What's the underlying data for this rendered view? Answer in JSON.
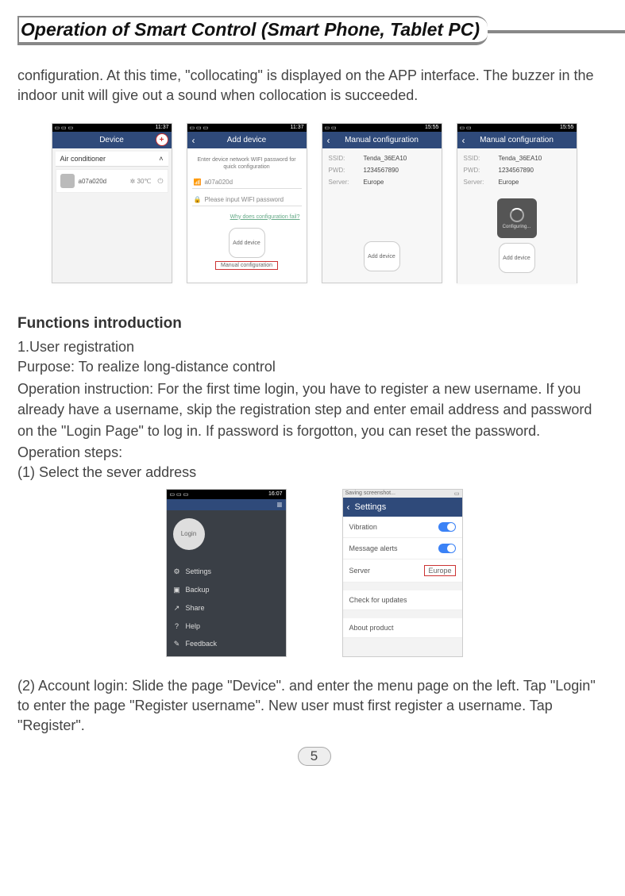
{
  "header": {
    "title": "Operation of Smart Control (Smart Phone, Tablet PC)"
  },
  "intro": "configuration. At this time, \"collocating\" is displayed on the APP interface. The buzzer in the indoor unit will give out a sound when collocation is succeeded.",
  "row1": {
    "s1": {
      "time": "11:37",
      "appbar": "Device",
      "tab": "Air conditioner",
      "dev_name": "a07a020d",
      "temp": "✲ 30℃"
    },
    "s2": {
      "time": "11:37",
      "appbar": "Add device",
      "hint": "Enter device network WIFI password for quick configuration",
      "ssid": "a07a020d",
      "pwd_ph": "Please input WIFI password",
      "why": "Why does configuration fail?",
      "btn": "Add device",
      "manual": "Manual configuration"
    },
    "s3": {
      "time": "15:55",
      "appbar": "Manual configuration",
      "ssid_k": "SSID:",
      "ssid_v": "Tenda_36EA10",
      "pwd_k": "PWD:",
      "pwd_v": "1234567890",
      "srv_k": "Server:",
      "srv_v": "Europe",
      "btn": "Add device"
    },
    "s4": {
      "time": "15:55",
      "appbar": "Manual configuration",
      "ssid_k": "SSID:",
      "ssid_v": "Tenda_36EA10",
      "pwd_k": "PWD:",
      "pwd_v": "1234567890",
      "srv_k": "Server:",
      "srv_v": "Europe",
      "cfg": "Configuring...",
      "btn": "Add device"
    }
  },
  "functions": {
    "heading": "Functions introduction",
    "l1": "1.User registration",
    "l2": "Purpose: To realize long-distance control",
    "l3": "Operation instruction: For the first time login, you have to register a new username. If you already have a username, skip the registration step and enter email address and password on the \"Login Page\" to log in. If password is forgotton, you can reset the password.",
    "l4": "Operation steps:",
    "l5": "(1) Select  the  sever address"
  },
  "row2": {
    "drawer": {
      "time": "16:07",
      "login": "Login",
      "items": [
        "Settings",
        "Backup",
        "Share",
        "Help",
        "Feedback"
      ],
      "icons": [
        "⚙",
        "▣",
        "↗",
        "?",
        "✎"
      ]
    },
    "settings": {
      "status": "Saving screenshot...",
      "title": "Settings",
      "vibration": "Vibration",
      "alerts": "Message alerts",
      "server_k": "Server",
      "server_v": "Europe",
      "updates": "Check for updates",
      "about": "About product"
    }
  },
  "para2": "(2) Account login: Slide the page \"Device\". and enter the menu page on the left. Tap \"Login\" to enter the page \"Register username\". New user must first register a username. Tap \"Register\".",
  "page_num": "5"
}
